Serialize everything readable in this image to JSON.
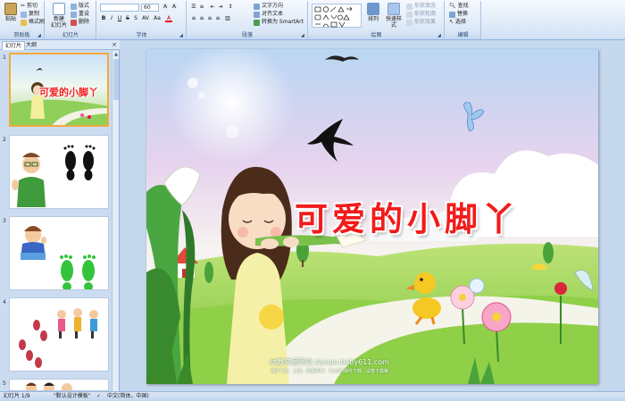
{
  "ribbon": {
    "clipboard": {
      "label": "剪贴板",
      "paste": "粘贴",
      "cut": "剪切",
      "copy": "复制",
      "format_painter": "格式刷"
    },
    "slides": {
      "label": "幻灯片",
      "new_slide": "新建\n幻灯片",
      "layout": "版式",
      "reset": "重设",
      "delete": "删除"
    },
    "font": {
      "label": "字体",
      "font_name": "",
      "font_size": "60"
    },
    "paragraph": {
      "label": "段落",
      "text_direction": "文字方向",
      "align_text": "对齐文本",
      "convert_smartart": "转换为 SmartArt"
    },
    "drawing": {
      "label": "绘图",
      "arrange": "排列",
      "quick_styles": "快速样式",
      "shape_fill": "形状填充",
      "shape_outline": "形状轮廓",
      "shape_effects": "形状效果"
    },
    "editing": {
      "label": "编辑",
      "find": "查找",
      "replace": "替换",
      "select": "选择"
    }
  },
  "panel": {
    "tab_slides": "幻灯片",
    "tab_outline": "大纲",
    "close": "×",
    "thumb_numbers": [
      "1",
      "2",
      "3",
      "4",
      "5"
    ]
  },
  "slide": {
    "title": "可爱的小脚丫",
    "site_line": "幼教资源网站 ziyuan.baby611.com",
    "sub_line": "课件下载　儿歌、故事MP3　FLASH课件下载　试卷下载等"
  },
  "status": {
    "slide_indicator": "幻灯片 1/9",
    "theme": "\"默认设计模板\"",
    "language": "中文(简体，中国)"
  },
  "colors": {
    "ribbon_bg": "#dde9f7",
    "selected_thumb_border": "#f2a93b",
    "title_red": "#f21b1b",
    "workspace_bg": "#c5d8ee"
  }
}
